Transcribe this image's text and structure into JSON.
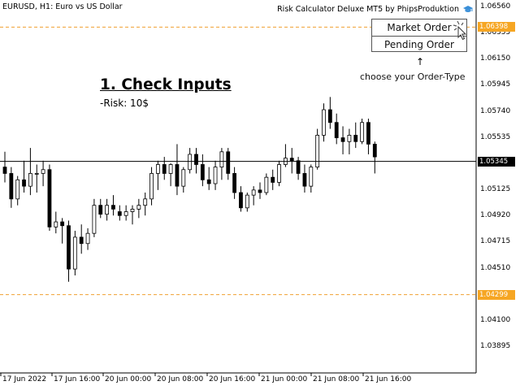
{
  "symbol_bar": {
    "text": "EURUSD, H1:  Euro vs US Dollar"
  },
  "indicator": {
    "name": "Risk Calculator Deluxe MT5 by PhipsProduktion",
    "icon": "graduation-cap-icon"
  },
  "order_panel": {
    "market_order_label": "Market Order",
    "pending_order_label": "Pending Order",
    "arrow": "↑",
    "hint": "choose your Order-Type"
  },
  "instructions": {
    "heading": "1. Check Inputs",
    "risk": "-Risk: 10$"
  },
  "price_axis": {
    "ticks": [
      "1.06560",
      "1.06355",
      "1.06150",
      "1.05945",
      "1.05740",
      "1.05535",
      "1.05330",
      "1.05125",
      "1.04920",
      "1.04715",
      "1.04510",
      "1.04305",
      "1.04100",
      "1.03895"
    ],
    "current_price": "1.05345",
    "upper_level": "1.06398",
    "lower_level": "1.04299"
  },
  "time_axis": {
    "ticks": [
      "17 Jun 2022",
      "17 Jun 16:00",
      "20 Jun 00:00",
      "20 Jun 08:00",
      "20 Jun 16:00",
      "21 Jun 00:00",
      "21 Jun 08:00",
      "21 Jun 16:00"
    ]
  },
  "colors": {
    "background": "#ffffff",
    "candle": "#000000",
    "level_line": "#f0a030",
    "level_label_bg": "#f6a623",
    "current_label_bg": "#000000",
    "icon_blue": "#3a8fd8"
  },
  "chart_data": {
    "type": "candlestick",
    "symbol": "EURUSD",
    "timeframe": "H1",
    "x_labels": [
      "17 Jun 2022",
      "17 Jun 16:00",
      "20 Jun 00:00",
      "20 Jun 08:00",
      "20 Jun 16:00",
      "21 Jun 00:00",
      "21 Jun 08:00",
      "21 Jun 16:00"
    ],
    "ylim": [
      1.0379,
      1.0662
    ],
    "horizontal_lines": [
      1.06398,
      1.05345,
      1.04299
    ],
    "candles": [
      [
        1.053,
        1.0542,
        1.0518,
        1.0525
      ],
      [
        1.0525,
        1.053,
        1.0498,
        1.0505
      ],
      [
        1.0505,
        1.0523,
        1.05,
        1.052
      ],
      [
        1.052,
        1.0535,
        1.051,
        1.0515
      ],
      [
        1.0515,
        1.0545,
        1.0508,
        1.0525
      ],
      [
        1.0525,
        1.0532,
        1.051,
        1.0525
      ],
      [
        1.0525,
        1.0535,
        1.0515,
        1.0528
      ],
      [
        1.0528,
        1.0532,
        1.048,
        1.0483
      ],
      [
        1.0483,
        1.0495,
        1.0478,
        1.0487
      ],
      [
        1.0487,
        1.049,
        1.047,
        1.0484
      ],
      [
        1.0484,
        1.0488,
        1.044,
        1.045
      ],
      [
        1.045,
        1.048,
        1.0445,
        1.0475
      ],
      [
        1.0475,
        1.0485,
        1.0462,
        1.047
      ],
      [
        1.047,
        1.0482,
        1.0465,
        1.0478
      ],
      [
        1.0478,
        1.0505,
        1.0475,
        1.05
      ],
      [
        1.05,
        1.0505,
        1.049,
        1.0493
      ],
      [
        1.0493,
        1.0505,
        1.0488,
        1.05
      ],
      [
        1.05,
        1.0508,
        1.0492,
        1.0497
      ],
      [
        1.0495,
        1.05,
        1.0488,
        1.0492
      ],
      [
        1.0492,
        1.05,
        1.0488,
        1.0495
      ],
      [
        1.0495,
        1.05,
        1.0485,
        1.0497
      ],
      [
        1.0497,
        1.0505,
        1.049,
        1.05
      ],
      [
        1.05,
        1.051,
        1.0492,
        1.0505
      ],
      [
        1.0505,
        1.053,
        1.05,
        1.0525
      ],
      [
        1.0525,
        1.0535,
        1.0512,
        1.0532
      ],
      [
        1.0532,
        1.0538,
        1.052,
        1.0525
      ],
      [
        1.0525,
        1.0533,
        1.0515,
        1.0532
      ],
      [
        1.0532,
        1.0548,
        1.0508,
        1.0515
      ],
      [
        1.0515,
        1.053,
        1.051,
        1.0528
      ],
      [
        1.0528,
        1.0545,
        1.0525,
        1.054
      ],
      [
        1.054,
        1.0545,
        1.0525,
        1.0532
      ],
      [
        1.0532,
        1.054,
        1.0515,
        1.052
      ],
      [
        1.052,
        1.053,
        1.0512,
        1.0517
      ],
      [
        1.0517,
        1.0535,
        1.0512,
        1.053
      ],
      [
        1.053,
        1.0545,
        1.052,
        1.0542
      ],
      [
        1.0542,
        1.0545,
        1.052,
        1.0525
      ],
      [
        1.0525,
        1.053,
        1.0505,
        1.051
      ],
      [
        1.051,
        1.0515,
        1.0495,
        1.0498
      ],
      [
        1.0498,
        1.051,
        1.0495,
        1.0508
      ],
      [
        1.0508,
        1.0515,
        1.05,
        1.0512
      ],
      [
        1.0512,
        1.0518,
        1.0505,
        1.051
      ],
      [
        1.051,
        1.0525,
        1.0508,
        1.0522
      ],
      [
        1.0522,
        1.0528,
        1.0512,
        1.0518
      ],
      [
        1.0518,
        1.0535,
        1.0515,
        1.0532
      ],
      [
        1.0532,
        1.0548,
        1.053,
        1.0537
      ],
      [
        1.0537,
        1.0545,
        1.0525,
        1.0535
      ],
      [
        1.0535,
        1.0538,
        1.052,
        1.0525
      ],
      [
        1.0525,
        1.0532,
        1.051,
        1.0515
      ],
      [
        1.0515,
        1.0532,
        1.051,
        1.053
      ],
      [
        1.053,
        1.056,
        1.0528,
        1.0555
      ],
      [
        1.0555,
        1.058,
        1.055,
        1.0575
      ],
      [
        1.0575,
        1.0585,
        1.056,
        1.0565
      ],
      [
        1.0565,
        1.0572,
        1.0548,
        1.0553
      ],
      [
        1.0553,
        1.0562,
        1.054,
        1.055
      ],
      [
        1.055,
        1.056,
        1.054,
        1.0555
      ],
      [
        1.0555,
        1.0565,
        1.0545,
        1.055
      ],
      [
        1.055,
        1.0568,
        1.0548,
        1.0565
      ],
      [
        1.0565,
        1.0568,
        1.054,
        1.0548
      ],
      [
        1.0548,
        1.055,
        1.0525,
        1.0538
      ]
    ]
  }
}
